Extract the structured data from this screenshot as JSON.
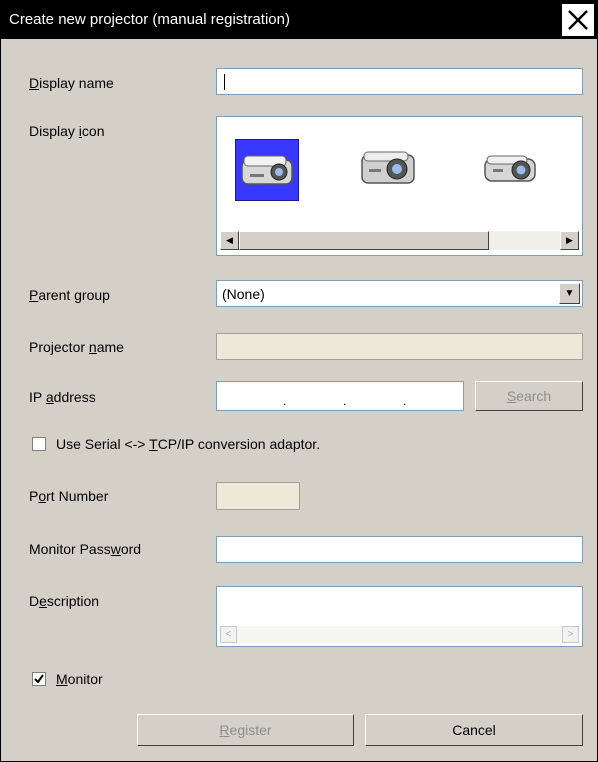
{
  "window": {
    "title": "Create new projector (manual registration)"
  },
  "labels": {
    "display_name_pre": "",
    "display_name_key": "D",
    "display_name_post": "isplay name",
    "display_icon_pre": "Display ",
    "display_icon_key": "i",
    "display_icon_post": "con",
    "parent_group_pre": "",
    "parent_group_key": "P",
    "parent_group_post": "arent group",
    "projector_name_pre": "Projector ",
    "projector_name_key": "n",
    "projector_name_post": "ame",
    "ip_address_pre": "IP ",
    "ip_address_key": "a",
    "ip_address_post": "ddress",
    "port_number_pre": "P",
    "port_number_key": "o",
    "port_number_post": "rt Number",
    "monitor_password_pre": "Monitor Pass",
    "monitor_password_key": "w",
    "monitor_password_post": "ord",
    "description_pre": "D",
    "description_key": "e",
    "description_post": "scription"
  },
  "fields": {
    "display_name_value": "",
    "parent_group_value": "(None)",
    "projector_name_value": "",
    "ip_address_dots": [
      ".",
      ".",
      "."
    ],
    "port_number_value": "",
    "monitor_password_value": "",
    "description_value": ""
  },
  "icons": [
    {
      "name": "projector-icon-1",
      "selected": true
    },
    {
      "name": "projector-icon-2",
      "selected": false
    },
    {
      "name": "projector-icon-3",
      "selected": false
    }
  ],
  "serial_option": {
    "label_pre": "Use Serial <-> ",
    "label_key": "T",
    "label_post": "CP/IP conversion adaptor.",
    "checked": false
  },
  "monitor_option": {
    "label_pre": "",
    "label_key": "M",
    "label_post": "onitor",
    "checked": true
  },
  "buttons": {
    "search_pre": "",
    "search_key": "S",
    "search_post": "earch",
    "register_pre": "",
    "register_key": "R",
    "register_post": "egister",
    "cancel": "Cancel"
  },
  "colors": {
    "selection": "#3838ff",
    "dialog_bg": "#d4d0c8",
    "title_bg": "#000000"
  }
}
